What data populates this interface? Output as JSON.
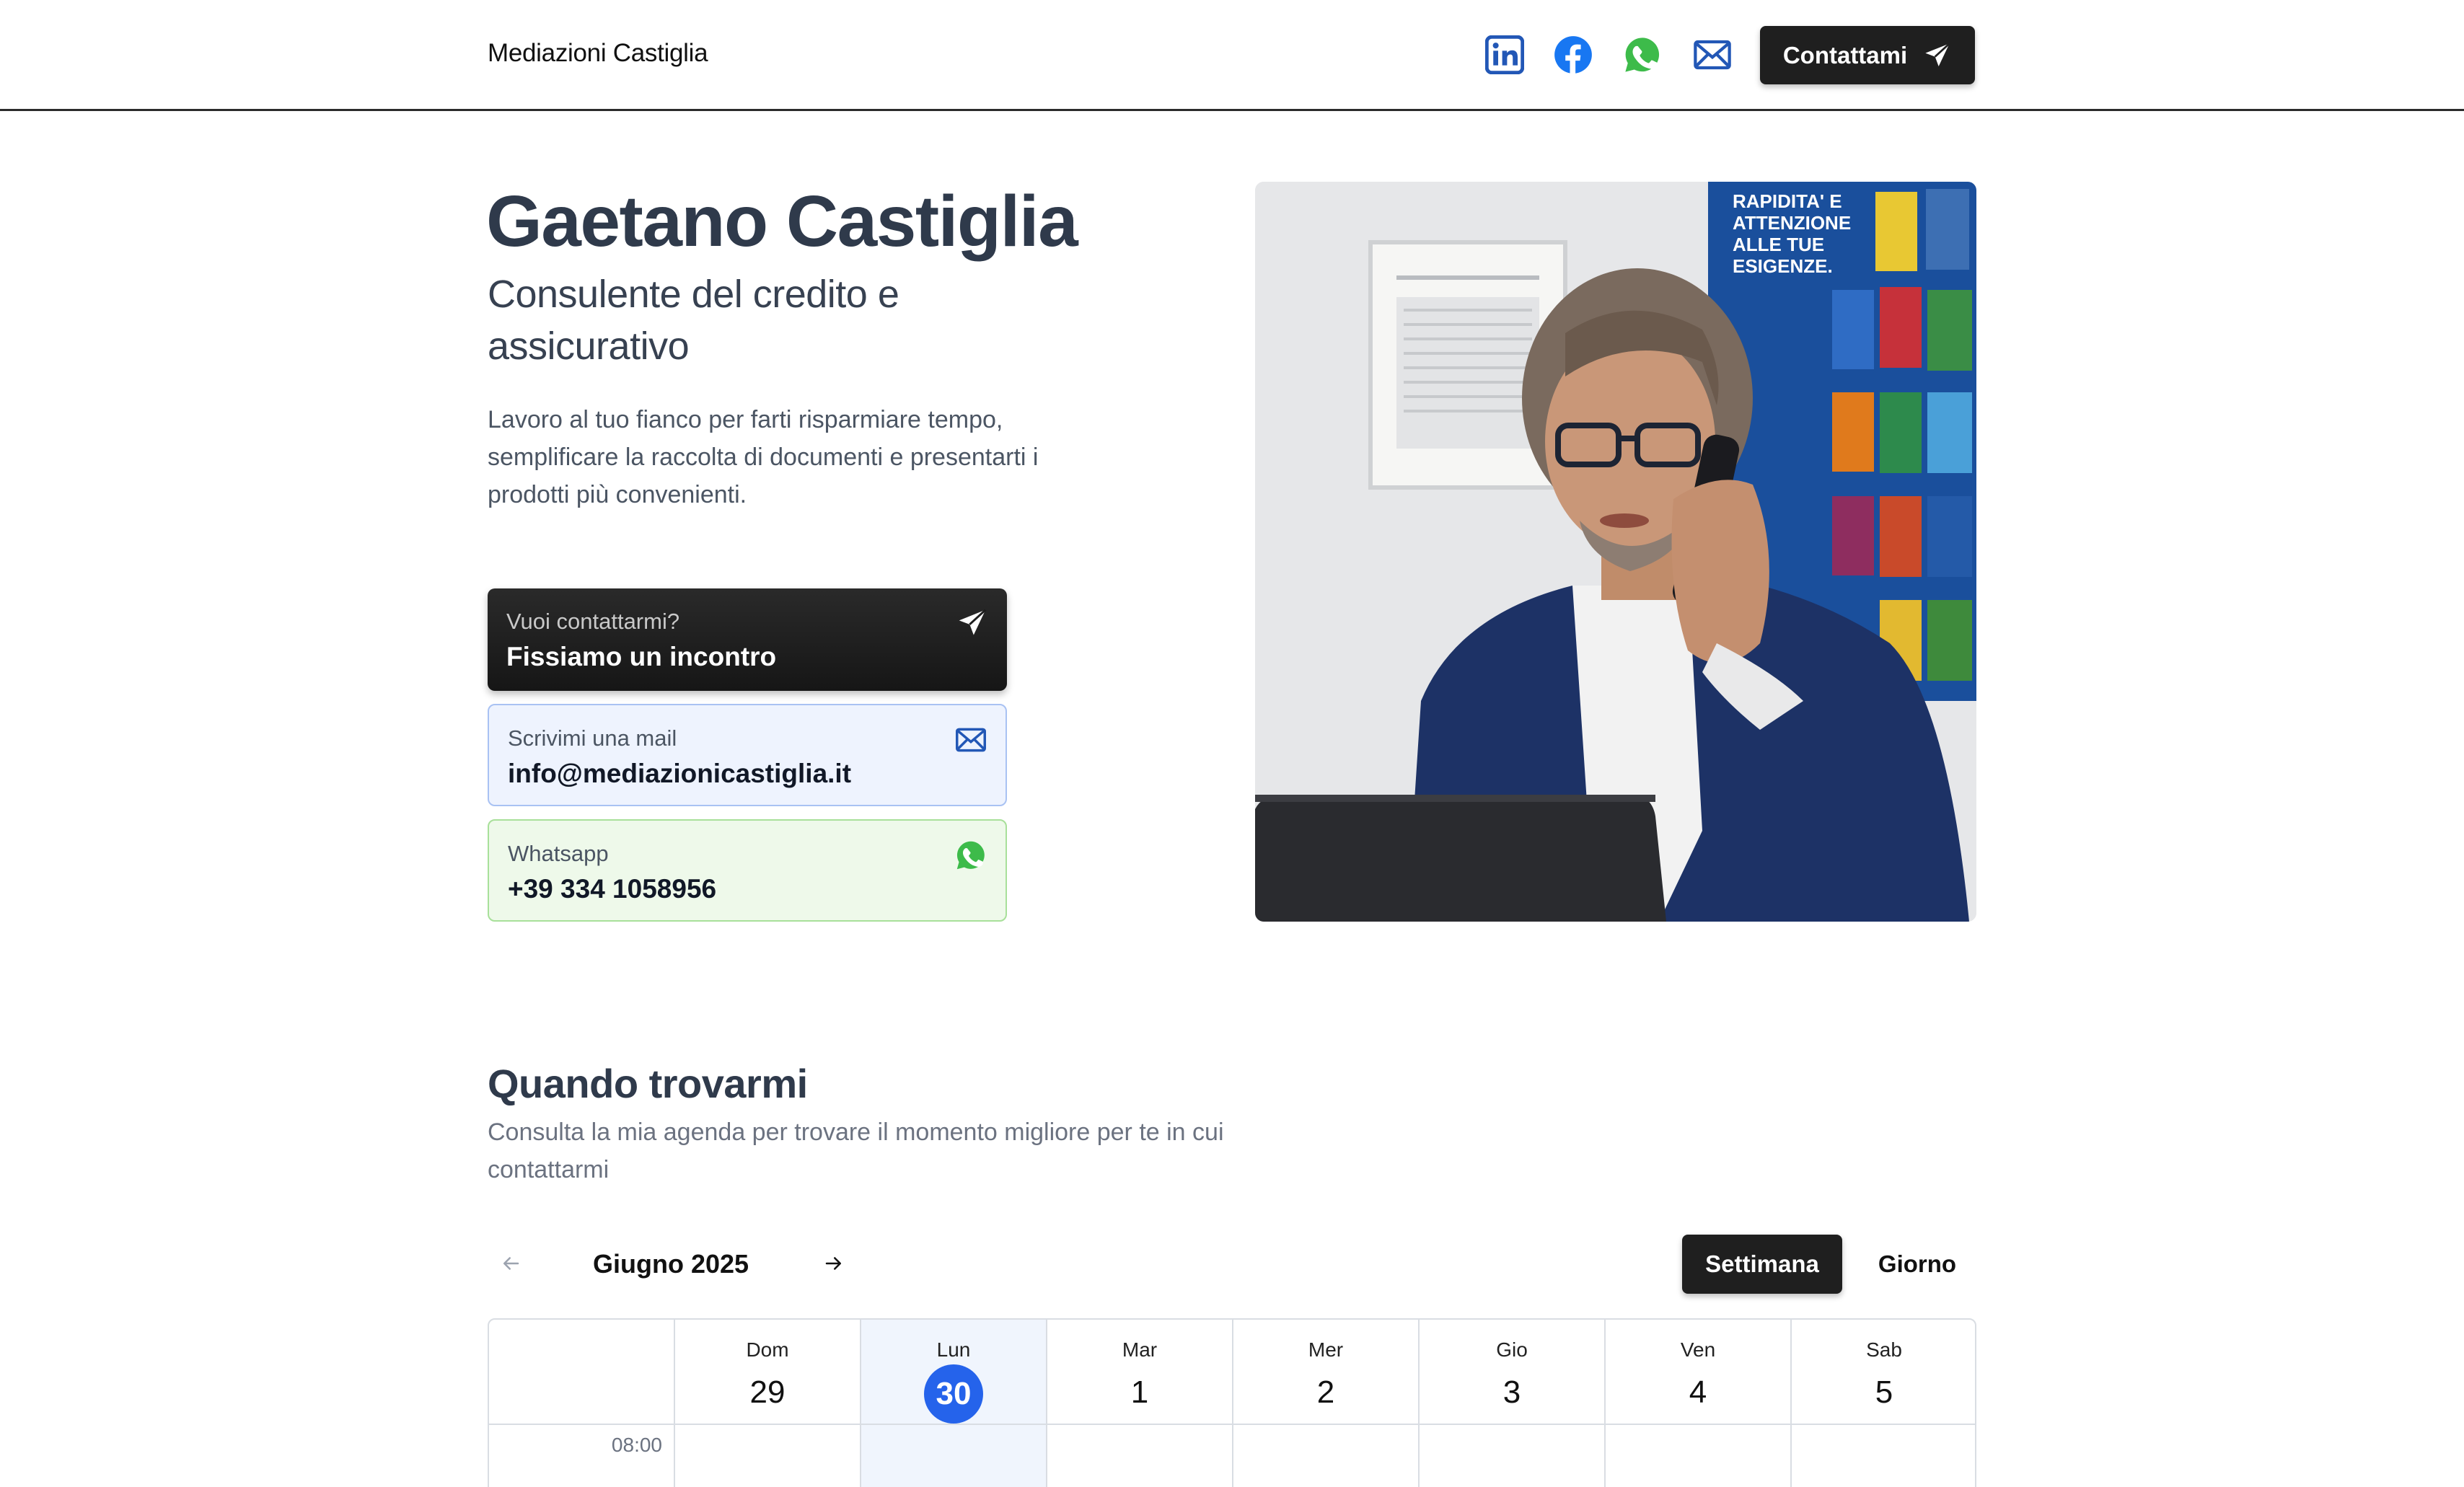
{
  "header": {
    "brand": "Mediazioni Castiglia",
    "social_icons": [
      "linkedin-icon",
      "facebook-icon",
      "whatsapp-icon",
      "mail-icon"
    ],
    "contact_button_label": "Contattami"
  },
  "hero": {
    "name": "Gaetano Castiglia",
    "role": "Consulente del credito e assicurativo",
    "intro": "Lavoro al tuo fianco per farti risparmiare tempo, semplificare la raccolta di documenti e presentarti i prodotti più convenienti."
  },
  "cards": {
    "meeting": {
      "subtitle": "Vuoi contattarmi?",
      "title": "Fissiamo un incontro"
    },
    "mail": {
      "subtitle": "Scrivimi una mail",
      "title": "info@mediazionicastiglia.it"
    },
    "whatsapp": {
      "subtitle": "Whatsapp",
      "title": "+39 334 1058956"
    }
  },
  "photo": {
    "poster_lines": [
      "RAPIDITA' E",
      "ATTENZIONE",
      "ALLE TUE",
      "ESIGENZE."
    ]
  },
  "agenda": {
    "title": "Quando trovarmi",
    "subtitle": "Consulta la mia agenda per trovare il momento migliore per te in cui contattarmi",
    "month": "Giugno 2025",
    "view_week": "Settimana",
    "view_day": "Giorno",
    "days": [
      {
        "dow": "Dom",
        "num": "29"
      },
      {
        "dow": "Lun",
        "num": "30"
      },
      {
        "dow": "Mar",
        "num": "1"
      },
      {
        "dow": "Mer",
        "num": "2"
      },
      {
        "dow": "Gio",
        "num": "3"
      },
      {
        "dow": "Ven",
        "num": "4"
      },
      {
        "dow": "Sab",
        "num": "5"
      }
    ],
    "first_time": "08:00"
  },
  "colors": {
    "accent": "#2563eb",
    "dark_button": "#1f1f1f",
    "heading": "#2f3a4b",
    "linkedin": "#0a66c2",
    "facebook": "#1877f2",
    "whatsapp": "#25d366"
  }
}
